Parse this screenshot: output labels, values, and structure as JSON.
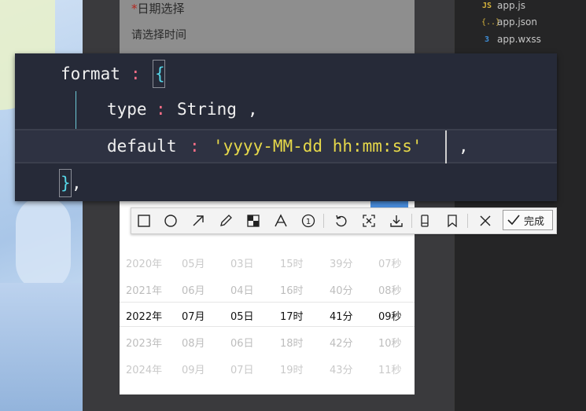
{
  "date_picker_form": {
    "required_mark": "*",
    "label": "日期选择",
    "placeholder": "请选择时间"
  },
  "explorer": {
    "files": [
      {
        "icon": "js-icon",
        "glyph": "JS",
        "name": "app.js"
      },
      {
        "icon": "json-icon",
        "glyph": "{..}",
        "name": "app.json"
      },
      {
        "icon": "css-icon",
        "glyph": "3",
        "name": "app.wxss"
      }
    ]
  },
  "code": {
    "line1": {
      "key": "format",
      "colon": ":",
      "brace": "{"
    },
    "line2": {
      "key": "type",
      "colon": ":",
      "value": "String",
      "comma": ","
    },
    "line3": {
      "key": "default",
      "colon": ":",
      "value": "'yyyy-MM-dd hh:mm:ss'",
      "comma": ","
    },
    "line4": {
      "brace": "}",
      "comma": ","
    }
  },
  "toolbar": {
    "tools": [
      "rectangle-tool",
      "ellipse-tool",
      "arrow-tool",
      "pen-tool",
      "mosaic-tool",
      "text-tool",
      "number-tool",
      "undo-tool",
      "ocr-tool",
      "download-tool",
      "pin-tool",
      "bookmark-tool",
      "close-tool"
    ],
    "done_label": "完成"
  },
  "picker": {
    "rows": [
      [
        "2020年",
        "05月",
        "03日",
        "15时",
        "39分",
        "07秒"
      ],
      [
        "2021年",
        "06月",
        "04日",
        "16时",
        "40分",
        "08秒"
      ],
      [
        "2022年",
        "07月",
        "05日",
        "17时",
        "41分",
        "09秒"
      ],
      [
        "2023年",
        "08月",
        "06日",
        "18时",
        "42分",
        "10秒"
      ],
      [
        "2024年",
        "09月",
        "07日",
        "19时",
        "43分",
        "11秒"
      ]
    ],
    "selected_index": 2
  },
  "colors": {
    "code_bg": "#262a38",
    "string": "#e6d84a",
    "punctuation": "#ff6e87",
    "brace": "#56d6e8"
  }
}
